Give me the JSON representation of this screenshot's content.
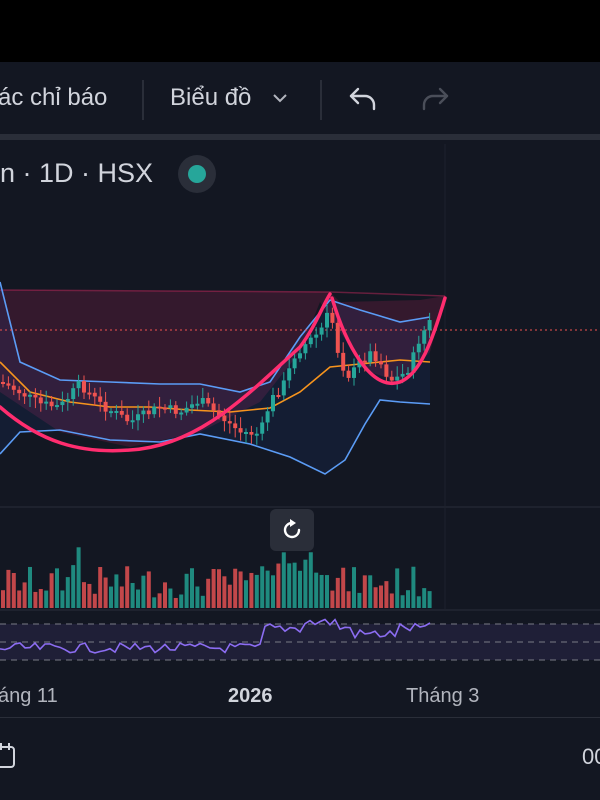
{
  "toolbar": {
    "indicators_label": "ác chỉ báo",
    "chart_type_label": "Biểu đồ",
    "undo_icon": "undo-icon",
    "redo_icon": "redo-icon"
  },
  "symbol": {
    "text": "n · 1D · HSX",
    "status_color": "#26a69a"
  },
  "axis": {
    "labels": [
      "áng 11",
      "2026",
      "Tháng 3"
    ]
  },
  "footer": {
    "right_text": "00",
    "calendar_icon": "calendar-icon"
  },
  "colors": {
    "background": "#131722",
    "up": "#26a69a",
    "down": "#ef5350",
    "pattern_outline": "#ff2d6f",
    "bollinger_band": "#5b9cf6",
    "moving_average": "#f7941d",
    "rsi_line": "#8c6df2"
  },
  "chart_data": {
    "type": "candlestick",
    "indicators": [
      "bollinger-bands",
      "moving-average",
      "volume",
      "rsi"
    ],
    "pattern": "cup-and-handle",
    "y_axis_labels": "not visible",
    "x_ticks": [
      "áng 11",
      "2026",
      "Tháng 3"
    ]
  }
}
